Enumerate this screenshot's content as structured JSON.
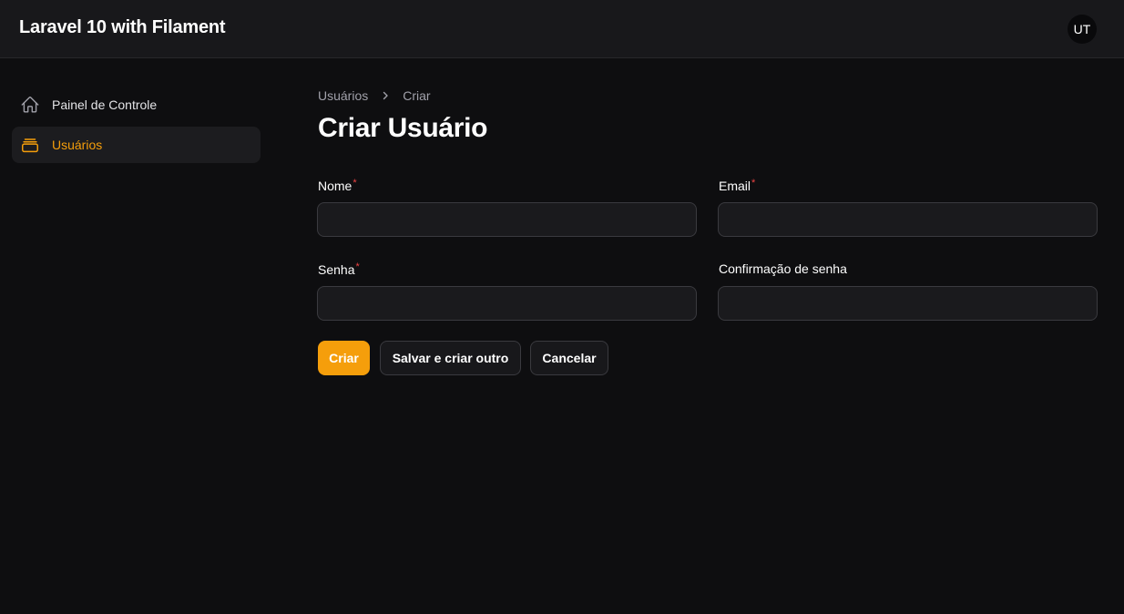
{
  "topbar": {
    "brand": "Laravel 10 with Filament",
    "avatar_initials": "UT"
  },
  "sidebar": {
    "items": [
      {
        "label": "Painel de Controle",
        "icon": "home-icon",
        "active": false
      },
      {
        "label": "Usuários",
        "icon": "stack-icon",
        "active": true
      }
    ]
  },
  "breadcrumb": {
    "items": [
      "Usuários",
      "Criar"
    ]
  },
  "page": {
    "title": "Criar Usuário"
  },
  "form": {
    "fields": [
      {
        "label": "Nome",
        "required": true,
        "value": ""
      },
      {
        "label": "Email",
        "required": true,
        "value": ""
      },
      {
        "label": "Senha",
        "required": true,
        "value": ""
      },
      {
        "label": "Confirmação de senha",
        "required": false,
        "value": ""
      }
    ],
    "required_marker": "*",
    "buttons": {
      "create": "Criar",
      "save_and_create_another": "Salvar e criar outro",
      "cancel": "Cancelar"
    }
  },
  "colors": {
    "accent": "#f59e0b",
    "background": "#0e0e10",
    "topbar": "#18181b",
    "required": "#ef4444"
  }
}
